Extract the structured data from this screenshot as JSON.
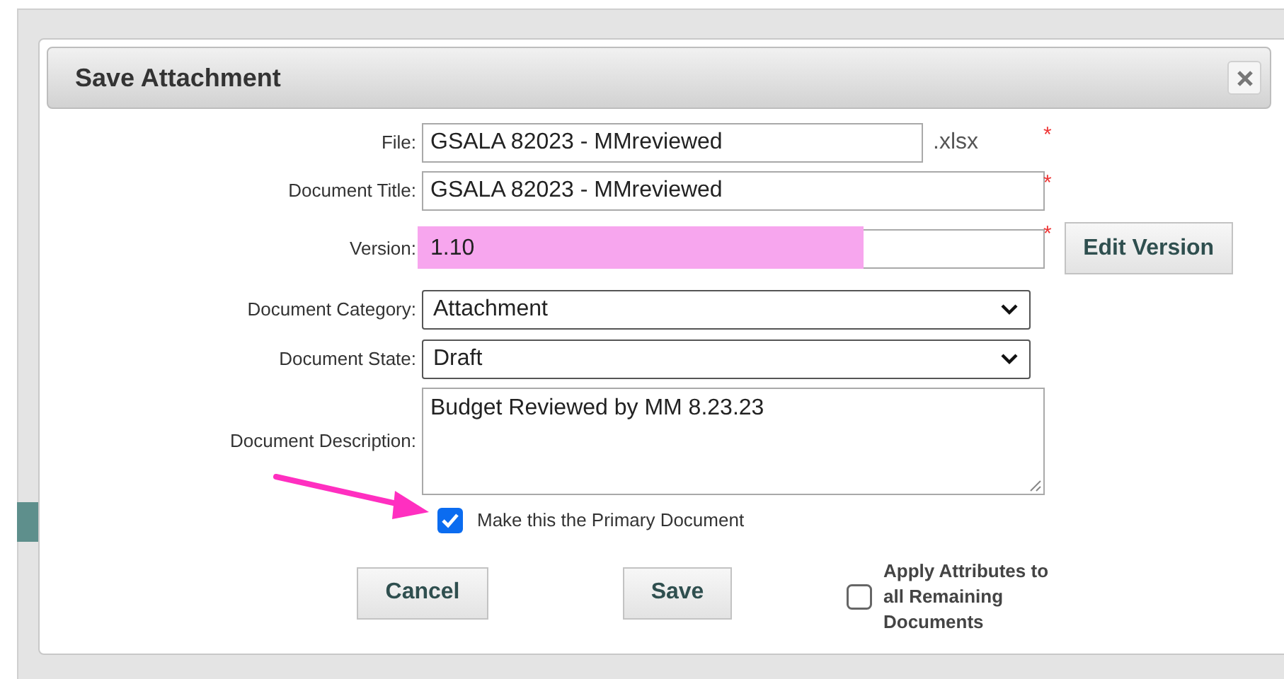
{
  "dialog": {
    "title": "Save Attachment",
    "fields": [
      {
        "kind": "text",
        "label": "File:",
        "value": "GSALA 82023 - MMreviewed",
        "suffix": ".xlsx",
        "required_mark": "*"
      },
      {
        "kind": "text",
        "label": "Document Title:",
        "value": "GSALA 82023 - MMreviewed",
        "required_mark": "*"
      },
      {
        "kind": "text",
        "label": "Version:",
        "value": "1.10",
        "required_mark": "*",
        "highlighted": true,
        "button": "Edit Version"
      },
      {
        "kind": "select",
        "label": "Document Category:",
        "value": "Attachment"
      },
      {
        "kind": "select",
        "label": "Document State:",
        "value": "Draft"
      },
      {
        "kind": "textarea",
        "label": "Document Description:",
        "value": "Budget Reviewed by MM 8.23.23"
      }
    ],
    "primary": {
      "label": "Make this the Primary Document",
      "checked": true
    },
    "buttons": [
      "Cancel",
      "Save"
    ],
    "apply": {
      "label": "Apply Attributes to all Remaining Documents",
      "checked": false
    }
  }
}
